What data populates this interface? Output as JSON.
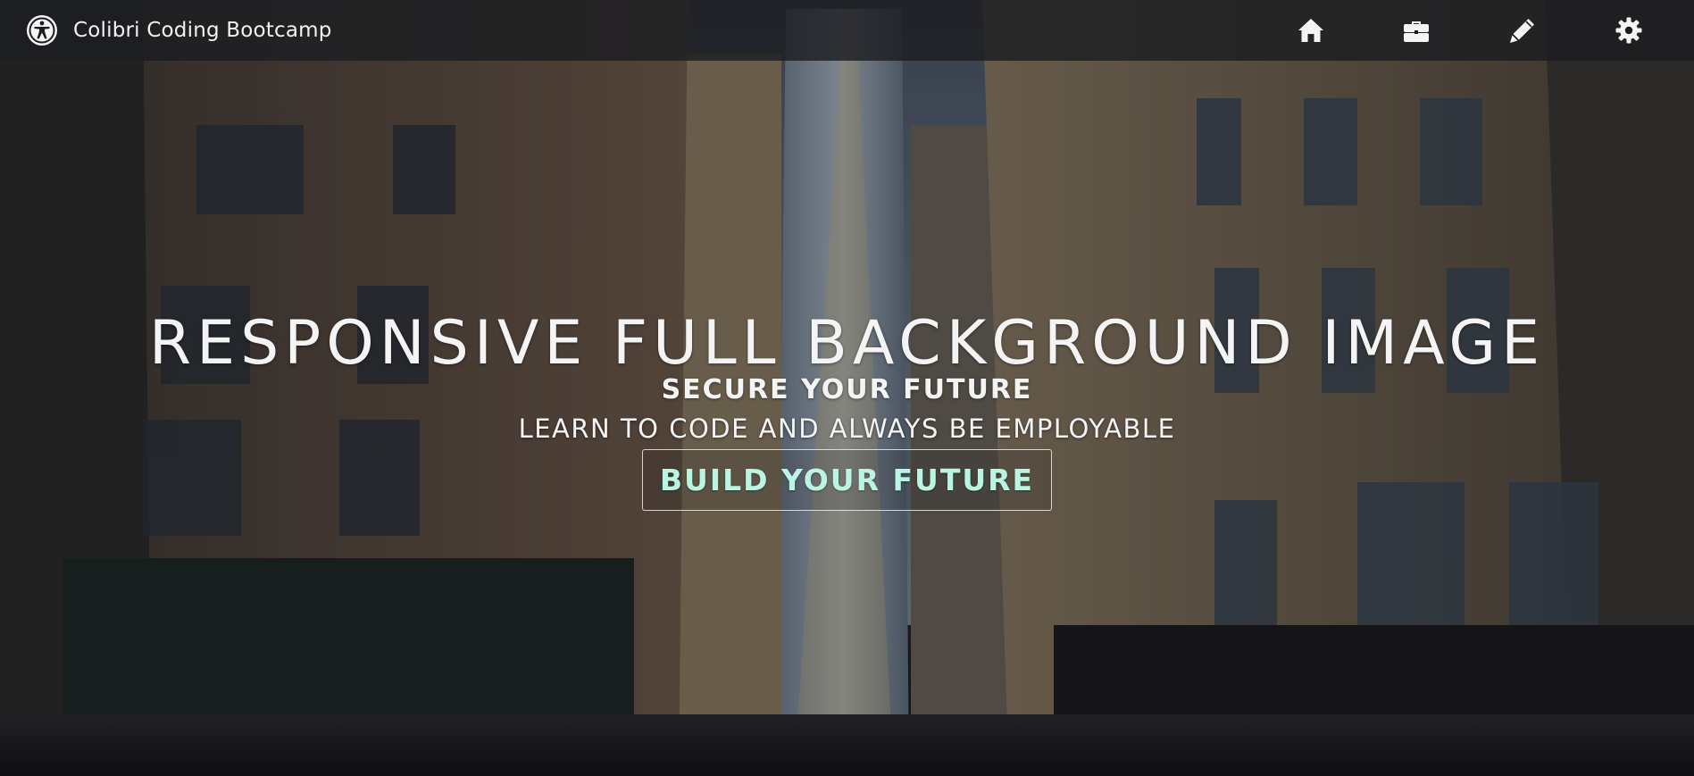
{
  "navbar": {
    "brand_title": "Colibri Coding Bootcamp",
    "brand_icon": "accessibility-icon",
    "icons": [
      {
        "name": "home-icon"
      },
      {
        "name": "briefcase-icon"
      },
      {
        "name": "pencil-icon"
      },
      {
        "name": "gear-icon"
      }
    ]
  },
  "hero": {
    "title": "RESPONSIVE FULL BACKGROUND IMAGE",
    "subtitle": "SECURE YOUR FUTURE",
    "tagline": "LEARN TO CODE AND ALWAYS BE EMPLOYABLE",
    "cta_label": "BUILD YOUR FUTURE"
  },
  "colors": {
    "navbar_bg": "#1c1d21",
    "text": "#f4f4f4",
    "cta_text": "#b9f5e2"
  }
}
